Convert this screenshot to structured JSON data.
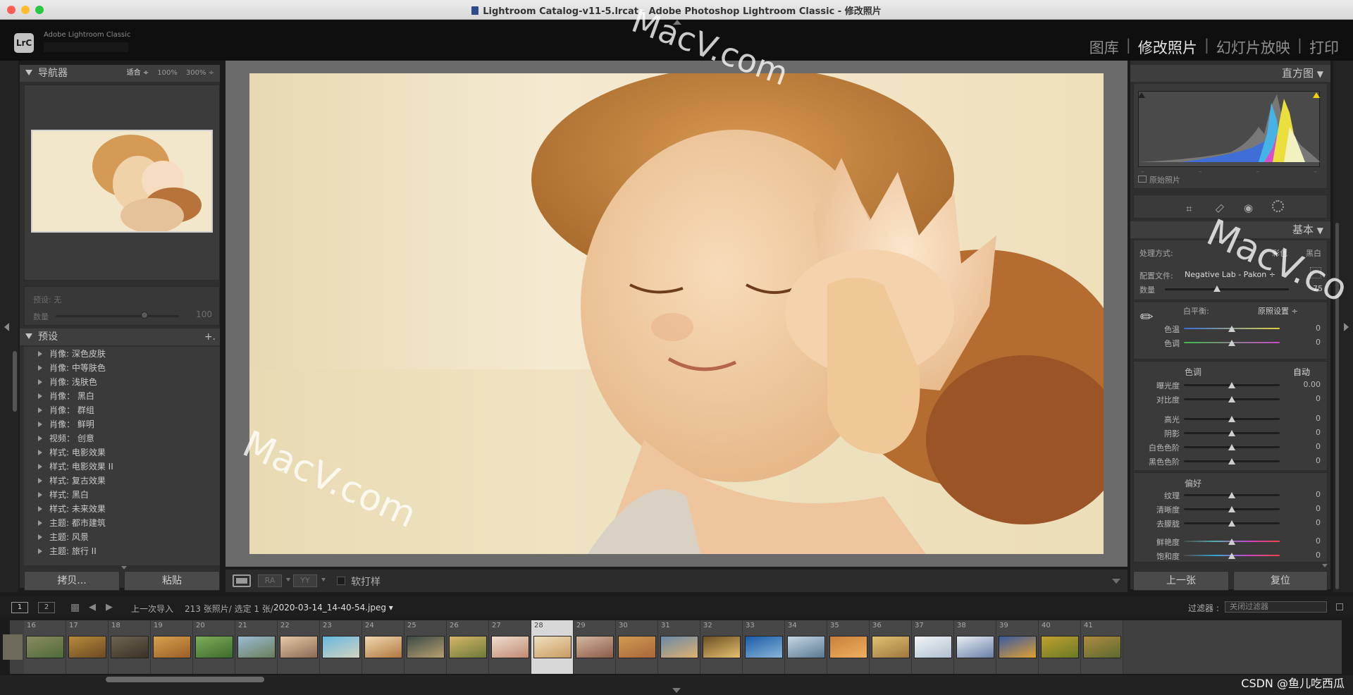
{
  "window": {
    "title": "Lightroom Catalog-v11-5.lrcat - Adobe Photoshop Lightroom Classic - 修改照片"
  },
  "identity": {
    "logo": "LrC",
    "brand": "Adobe Lightroom Classic"
  },
  "modules": {
    "library": "图库",
    "develop": "修改照片",
    "slideshow": "幻灯片放映",
    "print": "打印",
    "separator": "|"
  },
  "navigator": {
    "title": "导航器",
    "zoom_fit": "适合 ÷",
    "zoom_100": "100%",
    "zoom_300": "300% ÷"
  },
  "preset_amount": {
    "preset_label": "预设: 无",
    "amount_label": "数量",
    "amount_value": "100",
    "amount_fraction": 0.72
  },
  "presets": {
    "title": "预设",
    "add": "+.",
    "items": [
      "肖像: 深色皮肤",
      "肖像: 中等肤色",
      "肖像: 浅肤色",
      "肖像： 黑白",
      "肖像： 群组",
      "肖像： 鲜明",
      "视频： 创意",
      "样式: 电影效果",
      "样式: 电影效果 II",
      "样式: 复古效果",
      "样式: 黑白",
      "样式: 未来效果",
      "主题: 都市建筑",
      "主题: 风景",
      "主题: 旅行 II"
    ]
  },
  "left_buttons": {
    "copy": "拷贝...",
    "paste": "粘贴"
  },
  "toolbar": {
    "soft_proof": "软打样",
    "view_ra": "RA",
    "view_yy": "YY"
  },
  "histogram": {
    "title": "直方图",
    "original_photo": "原始照片",
    "ticks": [
      "–",
      "–",
      "–",
      "–"
    ]
  },
  "basic": {
    "title": "基本",
    "treatment_label": "处理方式:",
    "treatment_color": "彩色",
    "treatment_bw": "黑白",
    "profile_label": "配置文件:",
    "profile_value": "Negative Lab - Pakon ÷",
    "amount_label": "数量",
    "amount_value": "75",
    "amount_fraction": 0.42,
    "wb_label": "白平衡:",
    "wb_value": "原照设置 ÷",
    "tone_title": "色调",
    "auto": "自动",
    "presence_title": "偏好",
    "sliders": [
      {
        "label": "色温",
        "value": "0",
        "pos": 0.5
      },
      {
        "label": "色调",
        "value": "0",
        "pos": 0.5
      },
      {
        "label": "曝光度",
        "value": "0.00",
        "pos": 0.5
      },
      {
        "label": "对比度",
        "value": "0",
        "pos": 0.5
      },
      {
        "label": "高光",
        "value": "0",
        "pos": 0.5
      },
      {
        "label": "阴影",
        "value": "0",
        "pos": 0.5
      },
      {
        "label": "白色色阶",
        "value": "0",
        "pos": 0.5
      },
      {
        "label": "黑色色阶",
        "value": "0",
        "pos": 0.5
      },
      {
        "label": "纹理",
        "value": "0",
        "pos": 0.5
      },
      {
        "label": "清晰度",
        "value": "0",
        "pos": 0.5
      },
      {
        "label": "去朦胧",
        "value": "0",
        "pos": 0.5
      },
      {
        "label": "鲜艳度",
        "value": "0",
        "pos": 0.5
      },
      {
        "label": "饱和度",
        "value": "0",
        "pos": 0.5
      }
    ]
  },
  "right_buttons": {
    "previous": "上一张",
    "reset": "复位"
  },
  "filmbar": {
    "page1": "1",
    "page2": "2",
    "source": "上一次导入",
    "count": "213 张照片/ 选定 1 张/",
    "filename": "2020-03-14_14-40-54.jpeg ▾",
    "filter_label": "过滤器 :",
    "filter_value": "关闭过滤器"
  },
  "filmstrip": {
    "numbers": [
      "16",
      "17",
      "18",
      "19",
      "20",
      "21",
      "22",
      "23",
      "24",
      "25",
      "26",
      "27",
      "28",
      "29",
      "30",
      "31",
      "32",
      "33",
      "34",
      "35",
      "36",
      "37",
      "38",
      "39",
      "40",
      "41"
    ],
    "selected": "28"
  },
  "watermarks": {
    "wm1": "MacV.com",
    "wm2": "MacV.co",
    "wm3": "MacV.com"
  },
  "credit": "CSDN @鱼儿吃西瓜"
}
